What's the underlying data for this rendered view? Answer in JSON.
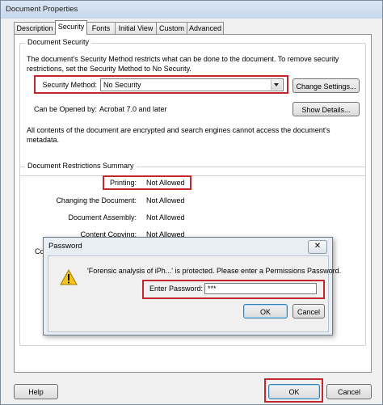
{
  "window": {
    "title": "Document Properties"
  },
  "tabs": [
    "Description",
    "Security",
    "Fonts",
    "Initial View",
    "Custom",
    "Advanced"
  ],
  "active_tab": "Security",
  "security": {
    "group_title": "Document Security",
    "description": "The document's Security Method restricts what can be done to the document. To remove security restrictions, set the Security Method to No Security.",
    "method_label": "Security Method:",
    "method_value": "No Security",
    "change_settings": "Change Settings...",
    "opened_by_label": "Can be Opened by:",
    "opened_by_value": "Acrobat 7.0 and later",
    "show_details": "Show Details...",
    "encryption_note": "All contents of the document are encrypted and search engines cannot access the document's metadata."
  },
  "restrictions": {
    "group_title": "Document Restrictions Summary",
    "rows": [
      {
        "label": "Printing:",
        "value": "Not Allowed"
      },
      {
        "label": "Changing the Document:",
        "value": "Not Allowed"
      },
      {
        "label": "Document Assembly:",
        "value": "Not Allowed"
      },
      {
        "label": "Content Copying:",
        "value": "Not Allowed"
      },
      {
        "label": "Co",
        "value": ""
      }
    ]
  },
  "password_dialog": {
    "title": "Password",
    "close_glyph": "✕",
    "message": "'Forensic analysis of iPh...' is protected. Please enter a Permissions Password.",
    "enter_label": "Enter Password:",
    "value": "***",
    "ok": "OK",
    "cancel": "Cancel"
  },
  "footer": {
    "help": "Help",
    "ok": "OK",
    "cancel": "Cancel"
  },
  "colors": {
    "highlight": "#c0282d",
    "titlebar": "#c6d7ec"
  }
}
